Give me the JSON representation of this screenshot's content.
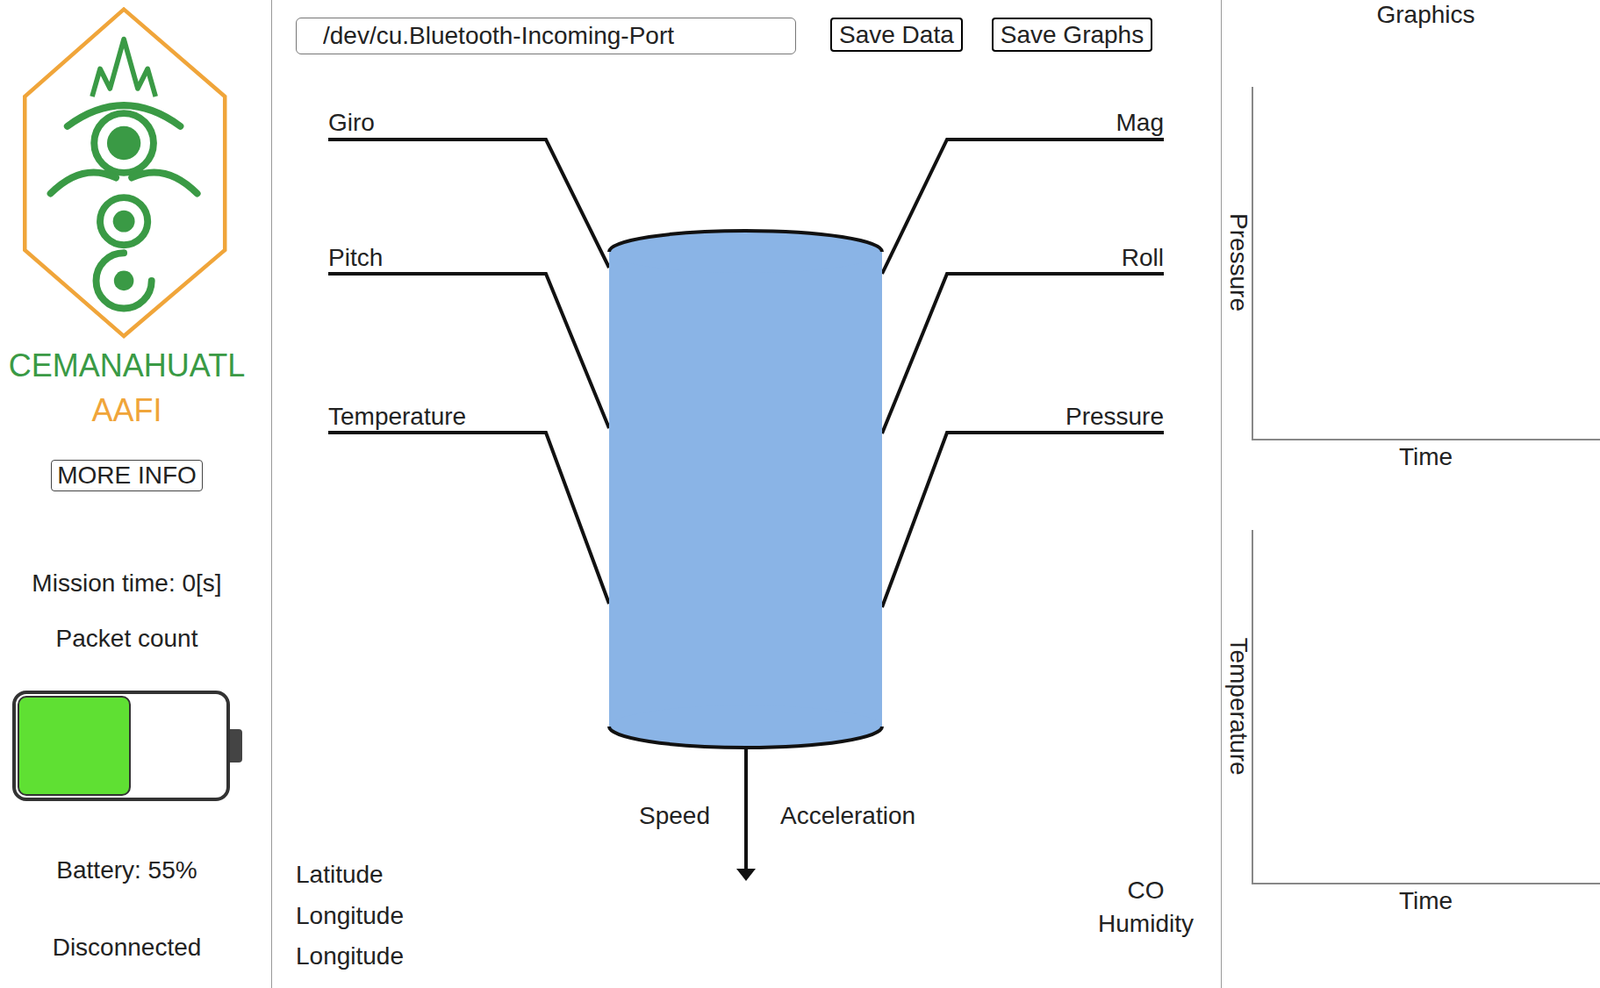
{
  "app": {
    "logo": {
      "name": "CEMANAHUATL",
      "subtitle": "AAFI"
    },
    "more_info": "MORE INFO"
  },
  "status": {
    "mission_time": "Mission time: 0[s]",
    "packet_count": "Packet count",
    "battery": {
      "level": 0.55,
      "reading": "Battery: 55%"
    },
    "connection": "Disconnected"
  },
  "toolbar": {
    "port": "/dev/cu.Bluetooth-Incoming-Port",
    "buttons": [
      "Save Data",
      "Save Graphs"
    ]
  },
  "diagram": {
    "left_labels": [
      "Giro",
      "Pitch",
      "Temperature"
    ],
    "right_labels": [
      "Mag",
      "Roll",
      "Pressure"
    ],
    "speed": "Speed",
    "acceleration": "Acceleration"
  },
  "gps": [
    "Latitude",
    "Longitude",
    "Longitude"
  ],
  "sensors": [
    "CO",
    "Humidity"
  ],
  "graphics": {
    "title": "Graphics",
    "charts": [
      {
        "y_label": "Pressure",
        "x_label": "Time"
      },
      {
        "y_label": "Temperature",
        "x_label": "Time"
      }
    ]
  }
}
